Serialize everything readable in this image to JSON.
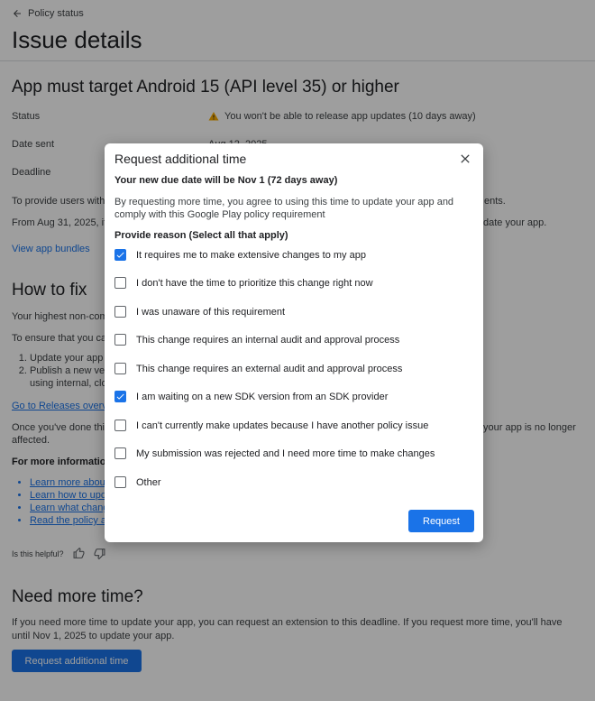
{
  "header": {
    "back_label": "Policy status",
    "title": "Issue details"
  },
  "issue": {
    "title": "App must target Android 15 (API level 35) or higher",
    "status_label": "Status",
    "status_value": "You won't be able to release app updates (10 days away)",
    "date_sent_label": "Date sent",
    "date_sent_value": "Aug 12, 2025",
    "deadline_label": "Deadline",
    "para1_a": "To provide users with a",
    "para1_b": "ents.",
    "para2_a": "From Aug 31, 2025, if y",
    "para2_b": "date your app.",
    "view_bundles_link": "View app bundles"
  },
  "how_to_fix": {
    "title": "How to fix",
    "line1": "Your highest non-comp",
    "line2": "To ensure that you can",
    "steps": [
      "Update your app t",
      "Publish a new vers using internal, clos"
    ],
    "releases_link": "Go to Releases overvie",
    "once_a": "Once you've done this,",
    "once_b": "your app is no longer",
    "once_c": "affected.",
    "more_info_label": "For more information:",
    "more_links": [
      "Learn more about",
      "Learn how to upda",
      "Learn what chang",
      "Read the policy an"
    ],
    "helpful_label": "Is this helpful?"
  },
  "more_time": {
    "title": "Need more time?",
    "text": "If you need more time to update your app, you can request an extension to this deadline. If you request more time, you'll have until Nov 1, 2025 to update your app.",
    "button_label": "Request additional time"
  },
  "dialog": {
    "title": "Request additional time",
    "due_text": "Your new due date will be Nov 1 (72 days away)",
    "description": "By requesting more time, you agree to using this time to update your app and comply with this Google Play policy requirement",
    "reason_label": "Provide reason (Select all that apply)",
    "options": [
      {
        "label": "It requires me to make extensive changes to my app",
        "checked": true
      },
      {
        "label": "I don't have the time to prioritize this change right now",
        "checked": false
      },
      {
        "label": "I was unaware of this requirement",
        "checked": false
      },
      {
        "label": "This change requires an internal audit and approval process",
        "checked": false
      },
      {
        "label": "This change requires an external audit and approval process",
        "checked": false
      },
      {
        "label": "I am waiting on a new SDK version from an SDK provider",
        "checked": true
      },
      {
        "label": "I can't currently make updates because I have another policy issue",
        "checked": false
      },
      {
        "label": "My submission was rejected and I need more time to make changes",
        "checked": false
      },
      {
        "label": "Other",
        "checked": false
      }
    ],
    "request_button": "Request"
  },
  "colors": {
    "accent": "#1a73e8",
    "warning": "#f9ab00",
    "overlay": "rgba(0,0,0,0.38)"
  }
}
